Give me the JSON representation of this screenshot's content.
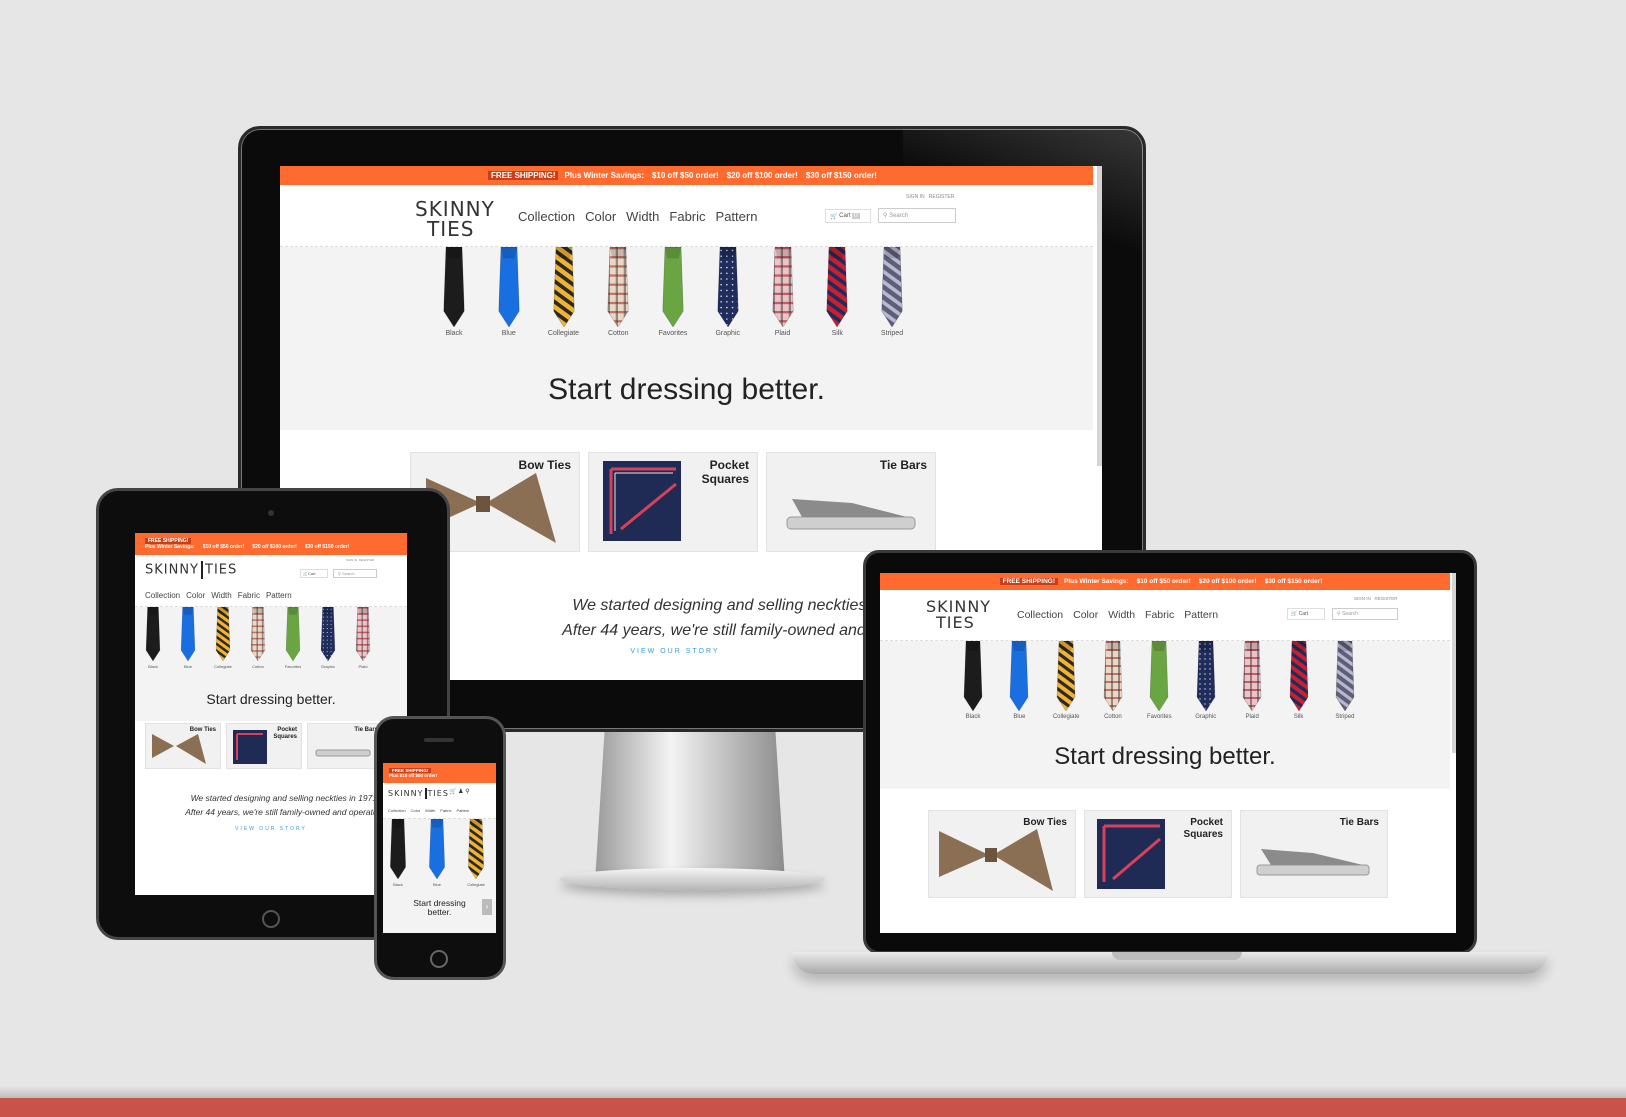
{
  "promo": {
    "badge": "FREE SHIPPING!",
    "winter": "Plus Winter Savings:",
    "deal1": "$10 off $50 order!",
    "deal2": "$20 off $100 order!",
    "deal3": "$30 off $150 order!",
    "phone_deal": "Plus $10 off $50 order!"
  },
  "brand": {
    "logo_top": "SKINNY",
    "logo_bottom": "TIES"
  },
  "nav": [
    "Collection",
    "Color",
    "Width",
    "Fabric",
    "Pattern"
  ],
  "utility": {
    "sign_in": "SIGN IN",
    "register": "REGISTER",
    "cart": "Cart",
    "cart_count": "0",
    "search_placeholder": "Search"
  },
  "ties": [
    {
      "label": "Black",
      "color": "#1c1c1c",
      "pattern": "solid"
    },
    {
      "label": "Blue",
      "color": "#1a6fe0",
      "pattern": "solid"
    },
    {
      "label": "Collegiate",
      "color": "#f2b233",
      "pattern": "stripe-dark"
    },
    {
      "label": "Cotton",
      "color": "#e8d8c8",
      "pattern": "plaid"
    },
    {
      "label": "Favorites",
      "color": "#6aa544",
      "pattern": "solid"
    },
    {
      "label": "Graphic",
      "color": "#1f2c5c",
      "pattern": "dots"
    },
    {
      "label": "Plaid",
      "color": "#e7c5c8",
      "pattern": "plaid-red"
    },
    {
      "label": "Silk",
      "color": "#c8202f",
      "pattern": "stripe-navy"
    },
    {
      "label": "Striped",
      "color": "#5d5e78",
      "pattern": "stripe-light"
    }
  ],
  "hero": {
    "headline": "Start dressing better.",
    "phone_headline_1": "Start dressing",
    "phone_headline_2": "better."
  },
  "categories": [
    {
      "title_1": "Bow Ties",
      "title_2": ""
    },
    {
      "title_1": "Pocket",
      "title_2": "Squares"
    },
    {
      "title_1": "Tie Bars",
      "title_2": ""
    }
  ],
  "story": {
    "line1": "We started designing and selling neckties in 1971.",
    "line2": "After 44 years, we're still family-owned and operated.",
    "link": "VIEW OUR STORY"
  },
  "colors": {
    "accent": "#ff6a2f",
    "link": "#3a9ad9",
    "band": "#c9524b"
  }
}
